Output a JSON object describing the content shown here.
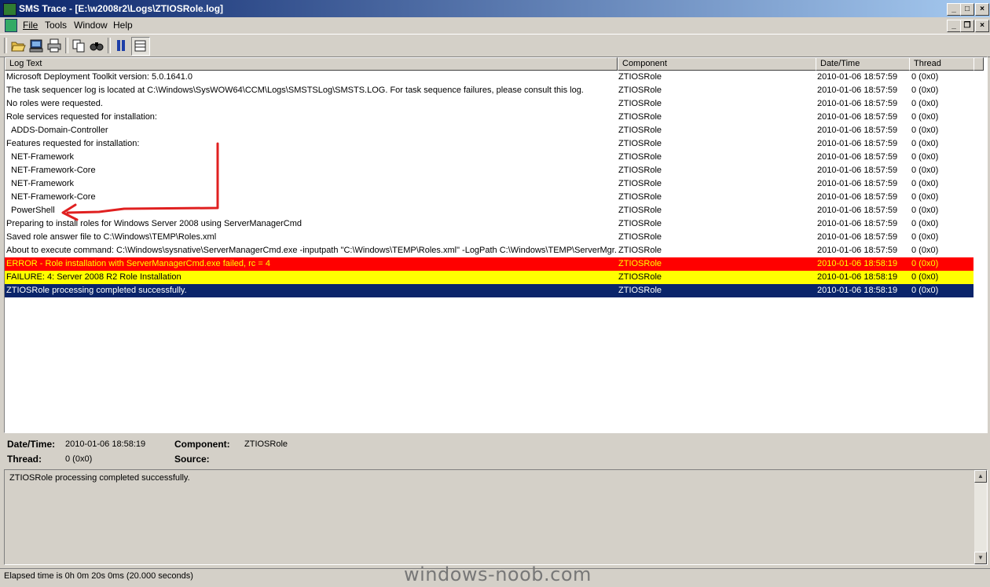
{
  "window": {
    "title": "SMS Trace - [E:\\w2008r2\\Logs\\ZTIOSRole.log]"
  },
  "menu": {
    "file_label": "File",
    "tools_label": "Tools",
    "window_label": "Window",
    "help_label": "Help"
  },
  "toolbar": {
    "icons": [
      "open-icon",
      "open-remote-icon",
      "print-icon",
      "copy-icon",
      "find-icon",
      "pause-icon",
      "details-pane-icon"
    ]
  },
  "list": {
    "columns": [
      "Log Text",
      "Component",
      "Date/Time",
      "Thread"
    ],
    "rows": [
      {
        "text": "Microsoft Deployment Toolkit version: 5.0.1641.0",
        "component": "ZTIOSRole",
        "datetime": "2010-01-06 18:57:59",
        "thread": "0 (0x0)",
        "indent": false,
        "level": "normal"
      },
      {
        "text": "The task sequencer log is located at C:\\Windows\\SysWOW64\\CCM\\Logs\\SMSTSLog\\SMSTS.LOG.  For task sequence failures, please consult this log.",
        "component": "ZTIOSRole",
        "datetime": "2010-01-06 18:57:59",
        "thread": "0 (0x0)",
        "indent": false,
        "level": "normal"
      },
      {
        "text": "No roles were requested.",
        "component": "ZTIOSRole",
        "datetime": "2010-01-06 18:57:59",
        "thread": "0 (0x0)",
        "indent": false,
        "level": "normal"
      },
      {
        "text": "Role services requested for installation:",
        "component": "ZTIOSRole",
        "datetime": "2010-01-06 18:57:59",
        "thread": "0 (0x0)",
        "indent": false,
        "level": "normal"
      },
      {
        "text": "ADDS-Domain-Controller",
        "component": "ZTIOSRole",
        "datetime": "2010-01-06 18:57:59",
        "thread": "0 (0x0)",
        "indent": true,
        "level": "normal"
      },
      {
        "text": "Features requested for installation:",
        "component": "ZTIOSRole",
        "datetime": "2010-01-06 18:57:59",
        "thread": "0 (0x0)",
        "indent": false,
        "level": "normal"
      },
      {
        "text": "NET-Framework",
        "component": "ZTIOSRole",
        "datetime": "2010-01-06 18:57:59",
        "thread": "0 (0x0)",
        "indent": true,
        "level": "normal"
      },
      {
        "text": "NET-Framework-Core",
        "component": "ZTIOSRole",
        "datetime": "2010-01-06 18:57:59",
        "thread": "0 (0x0)",
        "indent": true,
        "level": "normal"
      },
      {
        "text": "NET-Framework",
        "component": "ZTIOSRole",
        "datetime": "2010-01-06 18:57:59",
        "thread": "0 (0x0)",
        "indent": true,
        "level": "normal"
      },
      {
        "text": "NET-Framework-Core",
        "component": "ZTIOSRole",
        "datetime": "2010-01-06 18:57:59",
        "thread": "0 (0x0)",
        "indent": true,
        "level": "normal"
      },
      {
        "text": "PowerShell",
        "component": "ZTIOSRole",
        "datetime": "2010-01-06 18:57:59",
        "thread": "0 (0x0)",
        "indent": true,
        "level": "normal"
      },
      {
        "text": "Preparing to install roles for Windows Server 2008 using ServerManagerCmd",
        "component": "ZTIOSRole",
        "datetime": "2010-01-06 18:57:59",
        "thread": "0 (0x0)",
        "indent": false,
        "level": "normal"
      },
      {
        "text": "Saved role answer file to C:\\Windows\\TEMP\\Roles.xml",
        "component": "ZTIOSRole",
        "datetime": "2010-01-06 18:57:59",
        "thread": "0 (0x0)",
        "indent": false,
        "level": "normal"
      },
      {
        "text": "About to execute command: C:\\Windows\\sysnative\\ServerManagerCmd.exe -inputpath \"C:\\Windows\\TEMP\\Roles.xml\" -LogPath C:\\Windows\\TEMP\\ServerMgr.lo",
        "component": "ZTIOSRole",
        "datetime": "2010-01-06 18:57:59",
        "thread": "0 (0x0)",
        "indent": false,
        "level": "normal"
      },
      {
        "text": "ERROR - Role installation with ServerManagerCmd.exe failed, rc = 4",
        "component": "ZTIOSRole",
        "datetime": "2010-01-06 18:58:19",
        "thread": "0 (0x0)",
        "indent": false,
        "level": "error"
      },
      {
        "text": "FAILURE: 4: Server 2008 R2 Role Installation",
        "component": "ZTIOSRole",
        "datetime": "2010-01-06 18:58:19",
        "thread": "0 (0x0)",
        "indent": false,
        "level": "failure"
      },
      {
        "text": "ZTIOSRole processing completed successfully.",
        "component": "ZTIOSRole",
        "datetime": "2010-01-06 18:58:19",
        "thread": "0 (0x0)",
        "indent": false,
        "level": "selected"
      }
    ]
  },
  "details": {
    "datetime_label": "Date/Time:",
    "datetime_value": "2010-01-06 18:58:19",
    "component_label": "Component:",
    "component_value": "ZTIOSRole",
    "thread_label": "Thread:",
    "thread_value": "0 (0x0)",
    "source_label": "Source:",
    "source_value": ""
  },
  "message": {
    "text": "ZTIOSRole processing completed successfully."
  },
  "status": {
    "text": "Elapsed time is 0h 0m 20s 0ms (20.000 seconds)"
  },
  "watermark": {
    "text": "windows-noob.com"
  },
  "colors": {
    "error_bg": "#ff0000",
    "error_fg": "#ffff00",
    "failure_bg": "#ffff00",
    "selected_bg": "#0a246a",
    "annotation_arrow": "#e02020"
  }
}
